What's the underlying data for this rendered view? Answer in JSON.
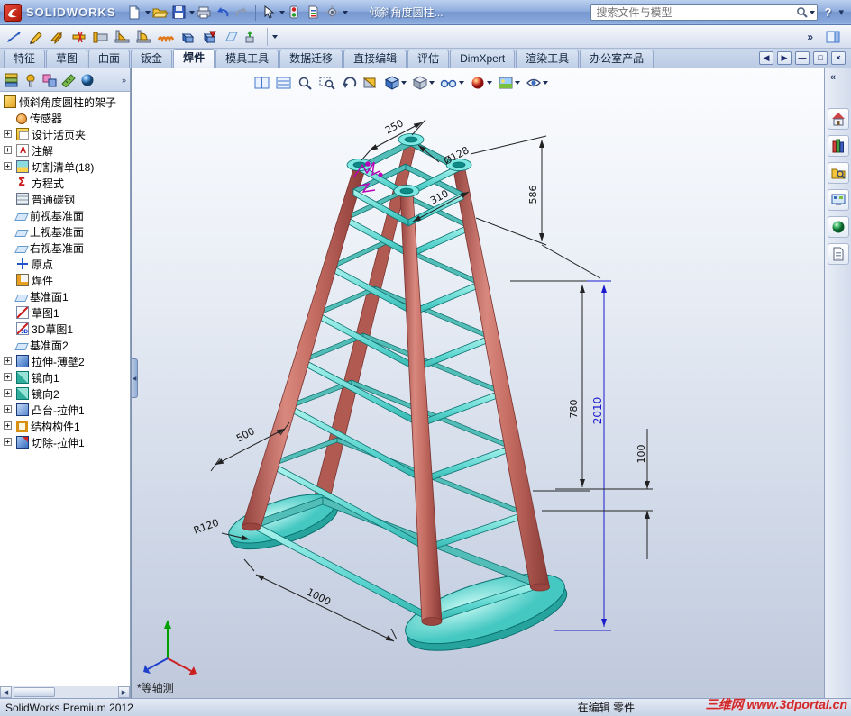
{
  "title_bar": {
    "app_name": "SOLIDWORKS",
    "doc_title": "倾斜角度圆柱...",
    "search_placeholder": "搜索文件与模型",
    "help_label": "?"
  },
  "command_tabs": [
    {
      "label": "特征"
    },
    {
      "label": "草图"
    },
    {
      "label": "曲面"
    },
    {
      "label": "钣金"
    },
    {
      "label": "焊件",
      "active": true
    },
    {
      "label": "模具工具"
    },
    {
      "label": "数据迁移"
    },
    {
      "label": "直接编辑"
    },
    {
      "label": "评估"
    },
    {
      "label": "DimXpert"
    },
    {
      "label": "渲染工具"
    },
    {
      "label": "办公室产品"
    }
  ],
  "feature_tree": {
    "root": "倾斜角度圆柱的架子",
    "items": [
      {
        "label": "传感器"
      },
      {
        "label": "设计活页夹",
        "expandable": true
      },
      {
        "label": "注解",
        "expandable": true
      },
      {
        "label": "切割清单(18)",
        "expandable": true
      },
      {
        "label": "方程式"
      },
      {
        "label": "普通碳钢"
      },
      {
        "label": "前视基准面"
      },
      {
        "label": "上视基准面"
      },
      {
        "label": "右视基准面"
      },
      {
        "label": "原点"
      },
      {
        "label": "焊件"
      },
      {
        "label": "基准面1"
      },
      {
        "label": "草图1"
      },
      {
        "label": "3D草图1"
      },
      {
        "label": "基准面2"
      },
      {
        "label": "拉伸-薄壁2",
        "expandable": true
      },
      {
        "label": "镜向1",
        "expandable": true
      },
      {
        "label": "镜向2",
        "expandable": true
      },
      {
        "label": "凸台-拉伸1",
        "expandable": true
      },
      {
        "label": "结构构件1",
        "expandable": true
      },
      {
        "label": "切除-拉伸1",
        "expandable": true
      }
    ]
  },
  "viewport": {
    "view_label": "*等轴测",
    "dims": {
      "top_width": "250",
      "diameter": "Ø128",
      "inner_width": "310",
      "upper_height": "586",
      "mid_height": "780",
      "total_height": "2010",
      "pad_gap": "100",
      "leg_span": "500",
      "pad_radius": "R120",
      "base_length": "1000"
    }
  },
  "status_bar": {
    "product": "SolidWorks Premium 2012",
    "editing": "在编辑 零件",
    "watermark": "三维网 www.3dportal.cn"
  },
  "colors": {
    "leg": "#c4685f",
    "tube": "#5fd8d2",
    "selected_dimension": "#1a1acc",
    "watermark": "#d01616",
    "titlebar": "#87a8dc"
  }
}
